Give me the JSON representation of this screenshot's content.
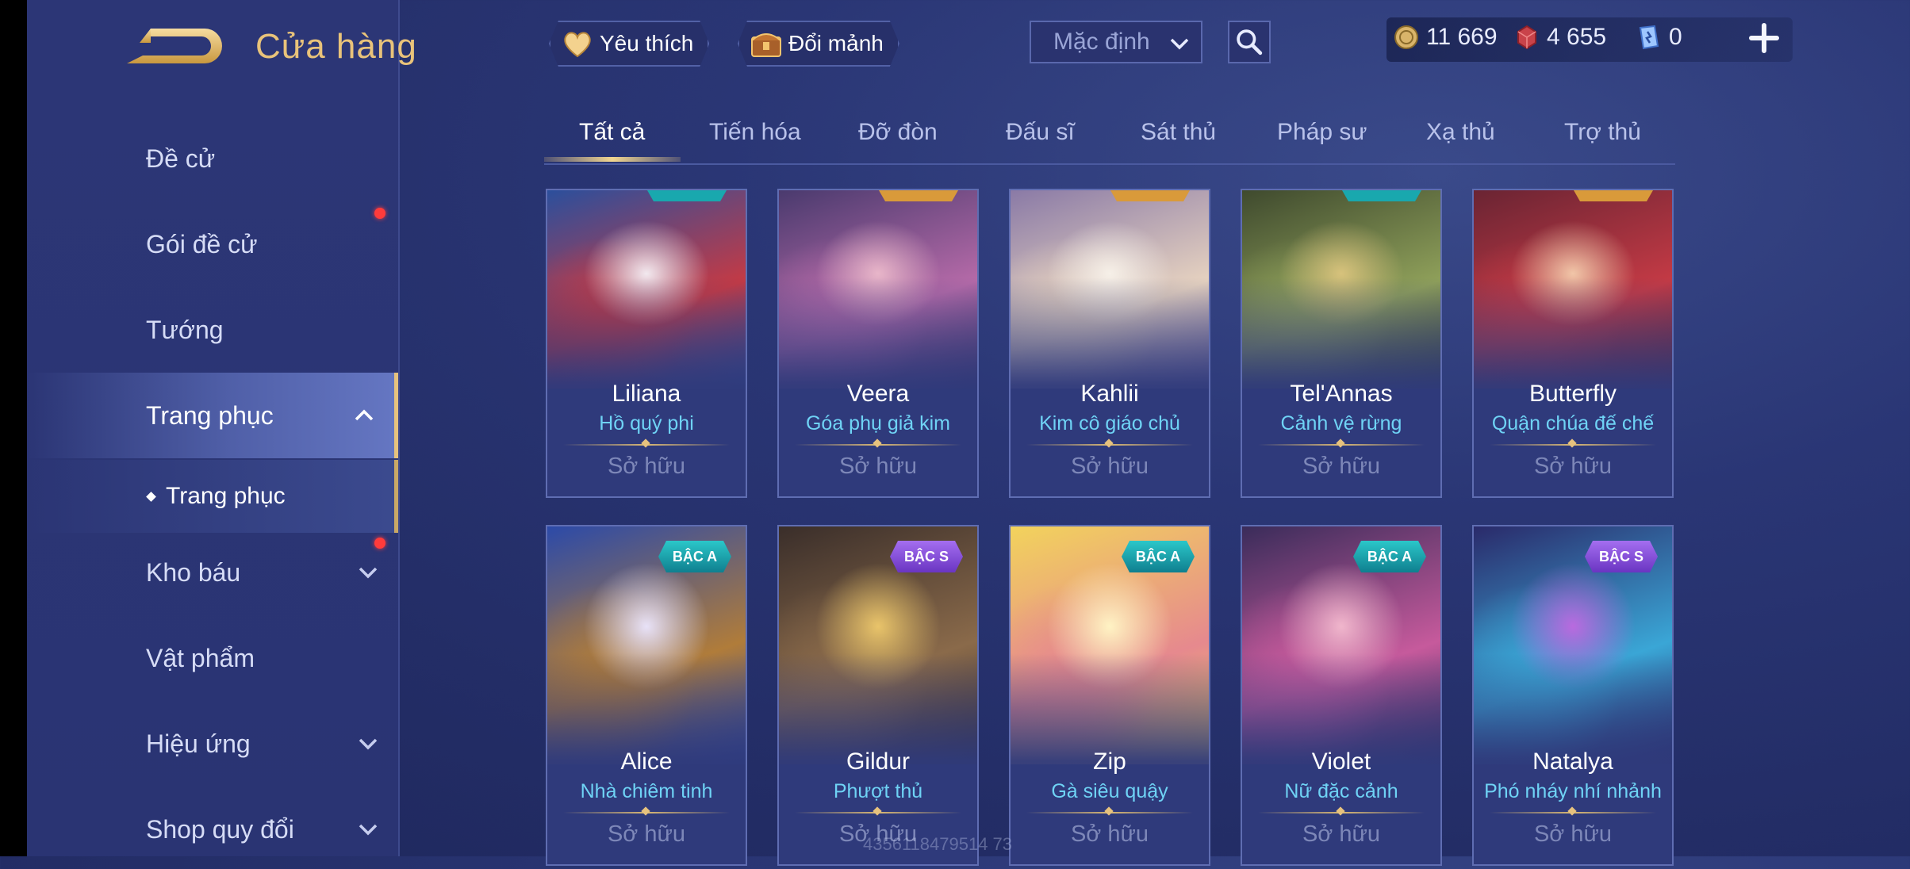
{
  "header": {
    "title": "Cửa hàng",
    "favorite_label": "Yêu thích",
    "exchange_label": "Đổi mảnh",
    "sort_value": "Mặc định"
  },
  "currency": [
    {
      "icon": "gold-coin-icon",
      "value": "11 669"
    },
    {
      "icon": "red-gem-icon",
      "value": "4 655"
    },
    {
      "icon": "voucher-icon",
      "value": "0"
    }
  ],
  "sidebar": {
    "items": [
      {
        "label": "Đề cử"
      },
      {
        "label": "Gói đề cử",
        "notify": true
      },
      {
        "label": "Tướng"
      },
      {
        "label": "Trang phục",
        "expanded": true,
        "active": true
      },
      {
        "label": "Kho báu",
        "notify": true
      },
      {
        "label": "Vật phẩm"
      },
      {
        "label": "Hiệu ứng"
      },
      {
        "label": "Shop quy đổi"
      }
    ],
    "sub_item": "Trang phục"
  },
  "tabs": [
    {
      "label": "Tất cả",
      "active": true
    },
    {
      "label": "Tiến hóa"
    },
    {
      "label": "Đỡ đòn"
    },
    {
      "label": "Đấu sĩ"
    },
    {
      "label": "Sát thủ"
    },
    {
      "label": "Pháp sư"
    },
    {
      "label": "Xạ thủ"
    },
    {
      "label": "Trợ thủ"
    }
  ],
  "cards": [
    {
      "hero": "Liliana",
      "skin": "Hồ quý phi",
      "status": "Sở hữu",
      "palette": "liliana"
    },
    {
      "hero": "Veera",
      "skin": "Góa phụ giả kim",
      "status": "Sở hữu",
      "palette": "veera"
    },
    {
      "hero": "Kahlii",
      "skin": "Kim cô giáo chủ",
      "status": "Sở hữu",
      "palette": "kahlii"
    },
    {
      "hero": "Tel'Annas",
      "skin": "Cảnh vệ rừng",
      "status": "Sở hữu",
      "palette": "telannas"
    },
    {
      "hero": "Butterfly",
      "skin": "Quận chúa đế chế",
      "status": "Sở hữu",
      "palette": "butterfly"
    },
    {
      "hero": "Alice",
      "skin": "Nhà chiêm tinh",
      "status": "Sở hữu",
      "badge": "BẬC A",
      "palette": "alice"
    },
    {
      "hero": "Gildur",
      "skin": "Phượt thủ",
      "status": "Sở hữu",
      "badge": "BẬC S",
      "palette": "gildur"
    },
    {
      "hero": "Zip",
      "skin": "Gà siêu quậy",
      "status": "Sở hữu",
      "badge": "BẬC A",
      "palette": "zip"
    },
    {
      "hero": "Violet",
      "skin": "Nữ đặc cảnh",
      "status": "Sở hữu",
      "badge": "BẬC A",
      "palette": "violet"
    },
    {
      "hero": "Natalya",
      "skin": "Phó nháy nhí nhảnh",
      "status": "Sở hữu",
      "badge": "BẬC S",
      "palette": "natalya"
    }
  ],
  "watermark": "4356118479514 73"
}
